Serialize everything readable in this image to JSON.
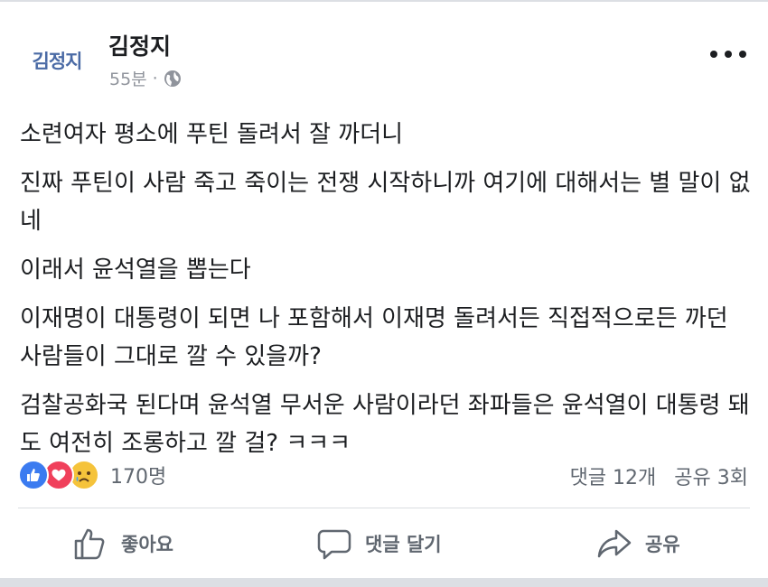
{
  "post": {
    "avatar_text": "김정지",
    "author": "김정지",
    "time": "55분",
    "separator": "·",
    "icons": {
      "privacy": "globe-icon",
      "menu": "more-options-icon"
    },
    "paragraphs": [
      "소련여자 평소에 푸틴 돌려서 잘 까더니",
      "진짜 푸틴이 사람 죽고 죽이는 전쟁 시작하니까 여기에 대해서는 별 말이 없네",
      "이래서 윤석열을 뽑는다",
      "이재명이 대통령이 되면 나 포함해서 이재명 돌려서든 직접적으로든 까던 사람들이 그대로 깔 수 있을까?",
      "검찰공화국 된다며 윤석열 무서운 사람이라던 좌파들은 윤석열이 대통령 돼도 여전히 조롱하고 깔 걸? ㅋㅋㅋ"
    ]
  },
  "reactions": {
    "types": [
      "like",
      "love",
      "sad"
    ],
    "colors": {
      "like": "#3b7bf0",
      "love": "#f0405b",
      "sad": "#f5c33b"
    },
    "count": "170명"
  },
  "stats": {
    "comments": "댓글 12개",
    "shares": "공유 3회"
  },
  "actions": {
    "like": "좋아요",
    "comment": "댓글 달기",
    "share": "공유"
  }
}
